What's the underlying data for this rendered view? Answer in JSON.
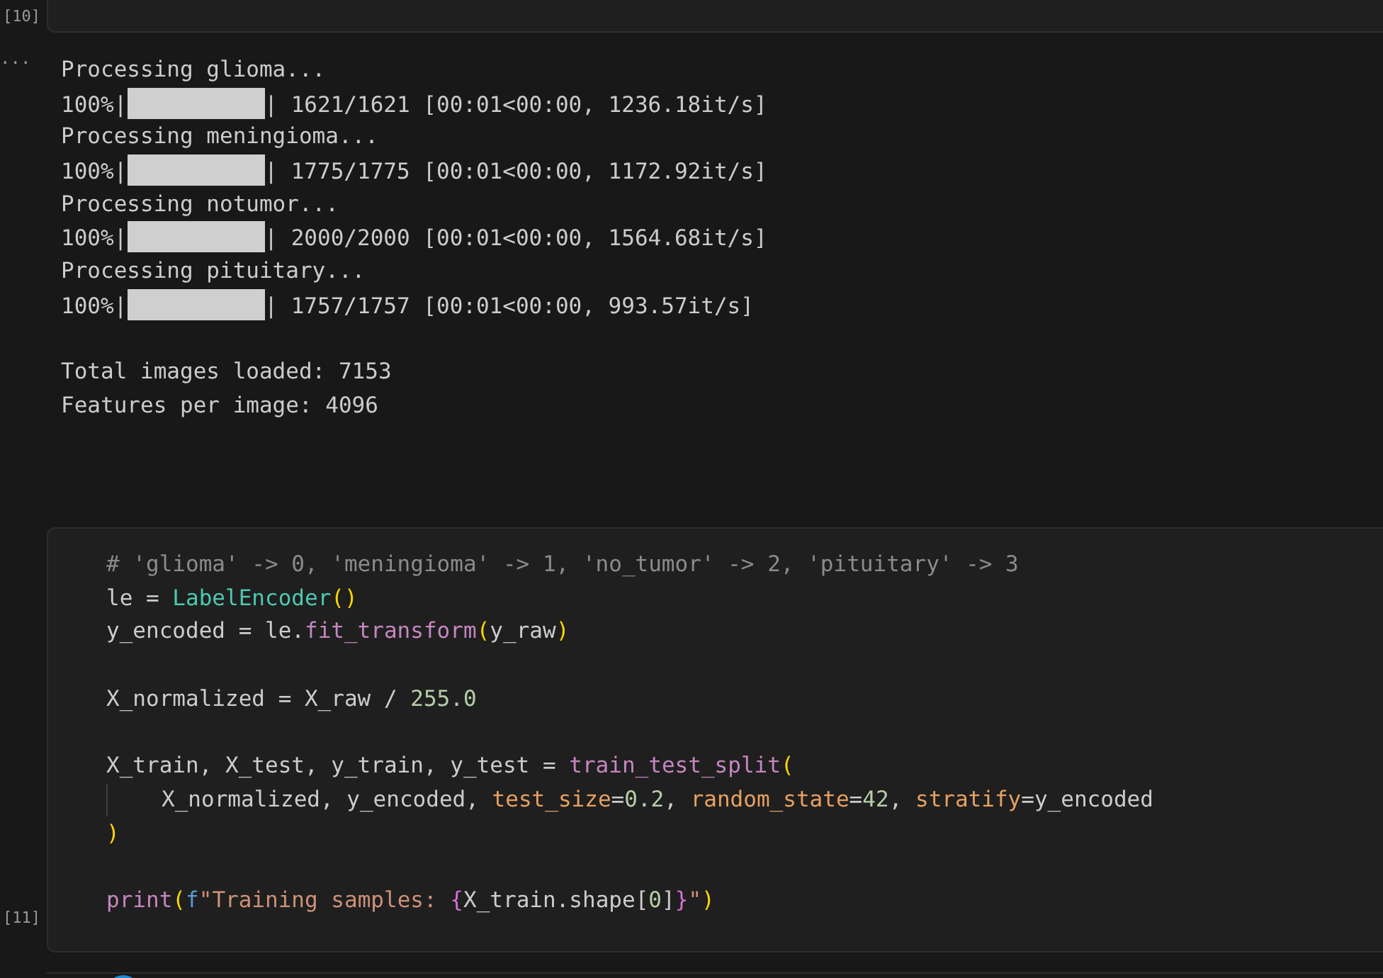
{
  "previous_cell": {
    "execution_count": "[10]"
  },
  "output": {
    "indicator": "...",
    "lines": [
      {
        "kind": "text",
        "text": "Processing glioma..."
      },
      {
        "kind": "progress",
        "prefix": "100%|",
        "level": 1,
        "suffix": "| 1621/1621 [00:01<00:00, 1236.18it/s]"
      },
      {
        "kind": "text",
        "text": "Processing meningioma..."
      },
      {
        "kind": "progress",
        "prefix": "100%|",
        "level": 1,
        "suffix": "| 1775/1775 [00:01<00:00, 1172.92it/s]"
      },
      {
        "kind": "text",
        "text": "Processing notumor..."
      },
      {
        "kind": "progress",
        "prefix": "100%|",
        "level": 1,
        "suffix": "| 2000/2000 [00:01<00:00, 1564.68it/s]"
      },
      {
        "kind": "text",
        "text": "Processing pituitary..."
      },
      {
        "kind": "progress",
        "prefix": "100%|",
        "level": 1,
        "suffix": "| 1757/1757 [00:01<00:00, 993.57it/s]"
      },
      {
        "kind": "blank"
      },
      {
        "kind": "text",
        "text": "Total images loaded: 7153"
      },
      {
        "kind": "text",
        "text": "Features per image: 4096"
      }
    ]
  },
  "code_cell": {
    "execution_count": "[11]",
    "lines": [
      {
        "kind": "code",
        "tokens": [
          {
            "kind": "comment",
            "text": "# 'glioma' -> 0, 'meningioma' -> 1, 'no_tumor' -> 2, 'pituitary' -> 3"
          }
        ]
      },
      {
        "kind": "code",
        "tokens": [
          {
            "kind": "plain",
            "text": "le = "
          },
          {
            "kind": "class",
            "text": "LabelEncoder"
          },
          {
            "kind": "paren",
            "text": "()"
          }
        ]
      },
      {
        "kind": "code",
        "tokens": [
          {
            "kind": "plain",
            "text": "y_encoded = le."
          },
          {
            "kind": "func",
            "text": "fit_transform"
          },
          {
            "kind": "paren",
            "text": "("
          },
          {
            "kind": "plain",
            "text": "y_raw"
          },
          {
            "kind": "paren",
            "text": ")"
          }
        ]
      },
      {
        "kind": "blank"
      },
      {
        "kind": "code",
        "tokens": [
          {
            "kind": "plain",
            "text": "X_normalized = X_raw / "
          },
          {
            "kind": "number",
            "text": "255.0"
          }
        ]
      },
      {
        "kind": "blank"
      },
      {
        "kind": "code",
        "tokens": [
          {
            "kind": "plain",
            "text": "X_train, X_test, y_train, y_test = "
          },
          {
            "kind": "func",
            "text": "train_test_split"
          },
          {
            "kind": "paren",
            "text": "("
          }
        ]
      },
      {
        "kind": "code",
        "indented": true,
        "tokens": [
          {
            "kind": "plain",
            "text": "X_normalized, y_encoded, "
          },
          {
            "kind": "param",
            "text": "test_size"
          },
          {
            "kind": "plain",
            "text": "="
          },
          {
            "kind": "number",
            "text": "0.2"
          },
          {
            "kind": "plain",
            "text": ", "
          },
          {
            "kind": "param",
            "text": "random_state"
          },
          {
            "kind": "plain",
            "text": "="
          },
          {
            "kind": "number",
            "text": "42"
          },
          {
            "kind": "plain",
            "text": ", "
          },
          {
            "kind": "param",
            "text": "stratify"
          },
          {
            "kind": "plain",
            "text": "=y_encoded"
          }
        ]
      },
      {
        "kind": "code",
        "tokens": [
          {
            "kind": "paren",
            "text": ")"
          }
        ]
      },
      {
        "kind": "blank"
      },
      {
        "kind": "code",
        "tokens": [
          {
            "kind": "func",
            "text": "print"
          },
          {
            "kind": "paren",
            "text": "("
          },
          {
            "kind": "keyword",
            "text": "f"
          },
          {
            "kind": "string",
            "text": "\"Training samples: "
          },
          {
            "kind": "brace",
            "text": "{"
          },
          {
            "kind": "plain",
            "text": "X_train.shape["
          },
          {
            "kind": "number",
            "text": "0"
          },
          {
            "kind": "plain",
            "text": "]"
          },
          {
            "kind": "brace",
            "text": "}"
          },
          {
            "kind": "string",
            "text": "\""
          },
          {
            "kind": "paren",
            "text": ")"
          }
        ]
      }
    ]
  }
}
